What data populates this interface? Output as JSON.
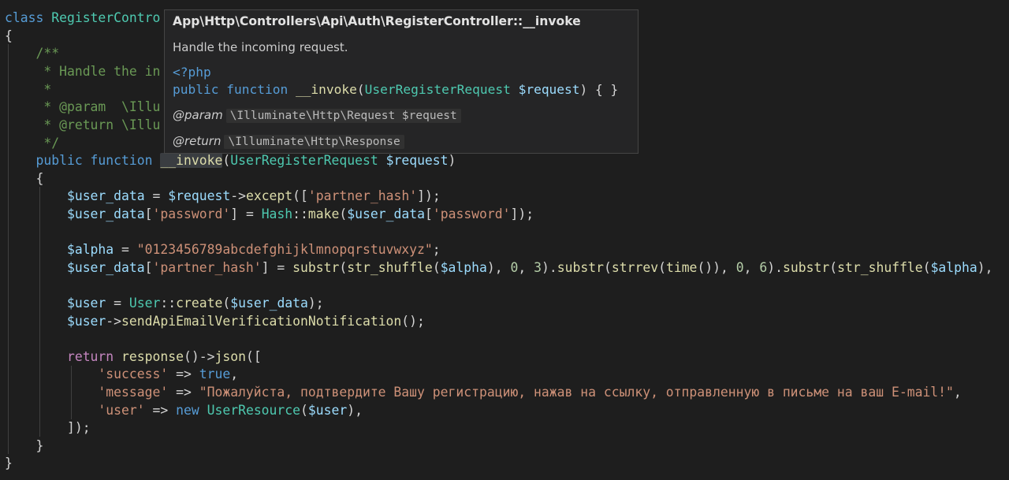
{
  "hover": {
    "title": "App\\Http\\Controllers\\Api\\Auth\\RegisterController::__invoke",
    "description": "Handle the incoming request.",
    "code_open": "<?php",
    "code_kw": "public function",
    "code_fn": "__invoke",
    "code_paren_open": "(",
    "code_type": "UserRegisterRequest",
    "code_var": "$request",
    "code_close": ") { }",
    "param_tag": "@param",
    "param_value": "\\Illuminate\\Http\\Request $request",
    "return_tag": "@return",
    "return_value": "\\Illuminate\\Http\\Response"
  },
  "code": {
    "l1_kw": "class",
    "l1_cls": "RegisterContro",
    "brace_open": "{",
    "brace_close": "}",
    "c_open": "/**",
    "c_handle": " * Handle the in",
    "c_star": " *",
    "c_param": " * @param  \\Illu",
    "c_return": " * @return \\Illu",
    "c_close": " */",
    "m_kw": "public function",
    "m_fn": "__invoke",
    "m_paren": "(",
    "m_type": "UserRegisterRequest",
    "m_var": "$request",
    "m_close": ")",
    "l8_var1": "$user_data",
    "l8_eq": " = ",
    "l8_var2": "$request",
    "l8_arrow": "->",
    "l8_fn": "except",
    "l8_p1": "([",
    "l8_str": "'partner_hash'",
    "l8_p2": "]);",
    "l9_var": "$user_data",
    "l9_b1": "[",
    "l9_str1": "'password'",
    "l9_b2": "] = ",
    "l9_cls": "Hash",
    "l9_dc": "::",
    "l9_fn": "make",
    "l9_p1": "(",
    "l9_var2": "$user_data",
    "l9_b3": "[",
    "l9_str2": "'password'",
    "l9_p2": "]);",
    "l11_var": "$alpha",
    "l11_eq": " = ",
    "l11_str": "\"0123456789abcdefghijklmnopqrstuvwxyz\"",
    "l11_end": ";",
    "l12_var": "$user_data",
    "l12_b1": "[",
    "l12_str": "'partner_hash'",
    "l12_b2": "] = ",
    "l12_fn1": "substr",
    "l12_p1": "(",
    "l12_fn2": "str_shuffle",
    "l12_p2": "(",
    "l12_var2": "$alpha",
    "l12_p3": "), ",
    "l12_n1": "0",
    "l12_c1": ", ",
    "l12_n2": "3",
    "l12_p4": ").",
    "l12_fn3": "substr",
    "l12_p5": "(",
    "l12_fn4": "strrev",
    "l12_p6": "(",
    "l12_fn5": "time",
    "l12_p7": "()), ",
    "l12_n3": "0",
    "l12_c2": ", ",
    "l12_n4": "6",
    "l12_p8": ").",
    "l12_fn6": "substr",
    "l12_p9": "(",
    "l12_fn7": "str_shuffle",
    "l12_p10": "(",
    "l12_var3": "$alpha",
    "l12_p11": "),",
    "l14_var": "$user",
    "l14_eq": " = ",
    "l14_cls": "User",
    "l14_dc": "::",
    "l14_fn": "create",
    "l14_p1": "(",
    "l14_var2": "$user_data",
    "l14_p2": ");",
    "l15_var": "$user",
    "l15_arrow": "->",
    "l15_fn": "sendApiEmailVerificationNotification",
    "l15_p": "();",
    "l17_ret": "return",
    "l17_sp": " ",
    "l17_fn1": "response",
    "l17_p1": "()->",
    "l17_fn2": "json",
    "l17_p2": "([",
    "l18_str": "'success'",
    "l18_arrow": " => ",
    "l18_kw": "true",
    "l18_c": ",",
    "l19_str": "'message'",
    "l19_arrow": " => ",
    "l19_val": "\"Пожалуйста, подтвердите Вашу регистрацию, нажав на ссылку, отправленную в письме на ваш E-mail!\"",
    "l19_c": ",",
    "l20_str": "'user'",
    "l20_arrow": " => ",
    "l20_kw": "new",
    "l20_sp": " ",
    "l20_cls": "UserResource",
    "l20_p1": "(",
    "l20_var": "$user",
    "l20_p2": "),",
    "l21": "]);",
    "l22": "}",
    "l23": "}"
  }
}
